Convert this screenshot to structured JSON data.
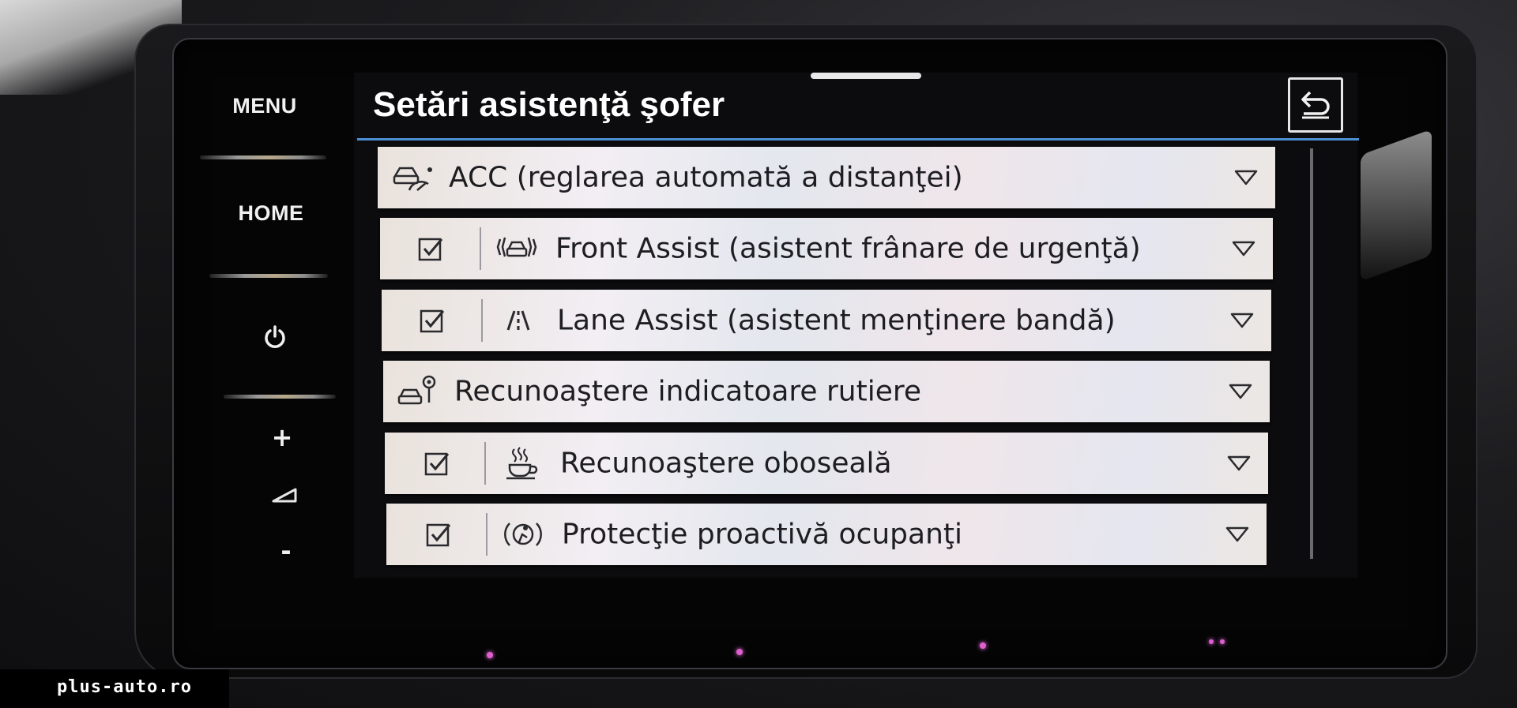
{
  "sidebar": {
    "menu_label": "MENU",
    "home_label": "HOME",
    "power_icon": "power-icon",
    "volume_up_label": "+",
    "volume_down_label": "-",
    "volume_icon": "volume-icon"
  },
  "screen": {
    "title": "Setări asistenţă şofer",
    "back_icon": "back-icon"
  },
  "settings": [
    {
      "label": "ACC (reglarea automată a distanţei)",
      "has_checkbox": false,
      "checked": false,
      "icon": "acc-icon"
    },
    {
      "label": "Front Assist (asistent frânare de urgenţă)",
      "has_checkbox": true,
      "checked": true,
      "icon": "front-assist-icon"
    },
    {
      "label": "Lane Assist (asistent menţinere bandă)",
      "has_checkbox": true,
      "checked": true,
      "icon": "lane-assist-icon"
    },
    {
      "label": "Recunoaştere indicatoare rutiere",
      "has_checkbox": false,
      "checked": false,
      "icon": "traffic-sign-icon"
    },
    {
      "label": "Recunoaştere oboseală",
      "has_checkbox": true,
      "checked": true,
      "icon": "coffee-cup-icon"
    },
    {
      "label": "Protecţie proactivă ocupanţi",
      "has_checkbox": true,
      "checked": true,
      "icon": "occupant-protection-icon"
    }
  ],
  "watermark": "plus-auto.ro",
  "colors": {
    "accent_line": "#4d8fd4",
    "row_background": "#ece8ec",
    "screen_background": "#0c0c0e"
  }
}
